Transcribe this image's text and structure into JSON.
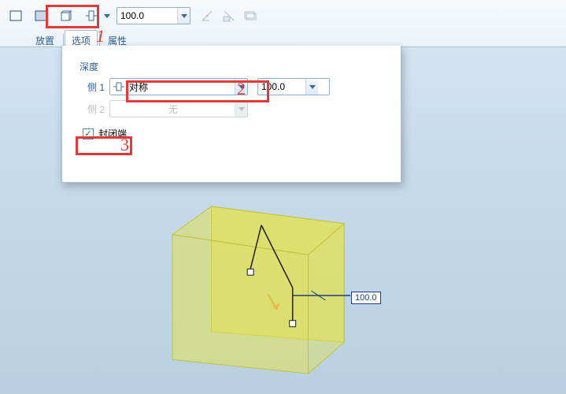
{
  "toolbar": {
    "value_input": "100.0"
  },
  "tabs": {
    "place": "放置",
    "options": "选项",
    "properties": "属性"
  },
  "panel": {
    "section": "深度",
    "side1_label": "侧 1",
    "side2_label": "侧 2",
    "side1_mode": "对称",
    "side2_mode": "无",
    "side1_value": "100.0",
    "close_end_label": "封闭端",
    "close_end_checked": "✓"
  },
  "annotations": {
    "n1": "1",
    "n2": "2",
    "n3": "3"
  },
  "viewport": {
    "dim_value": "100.0"
  }
}
